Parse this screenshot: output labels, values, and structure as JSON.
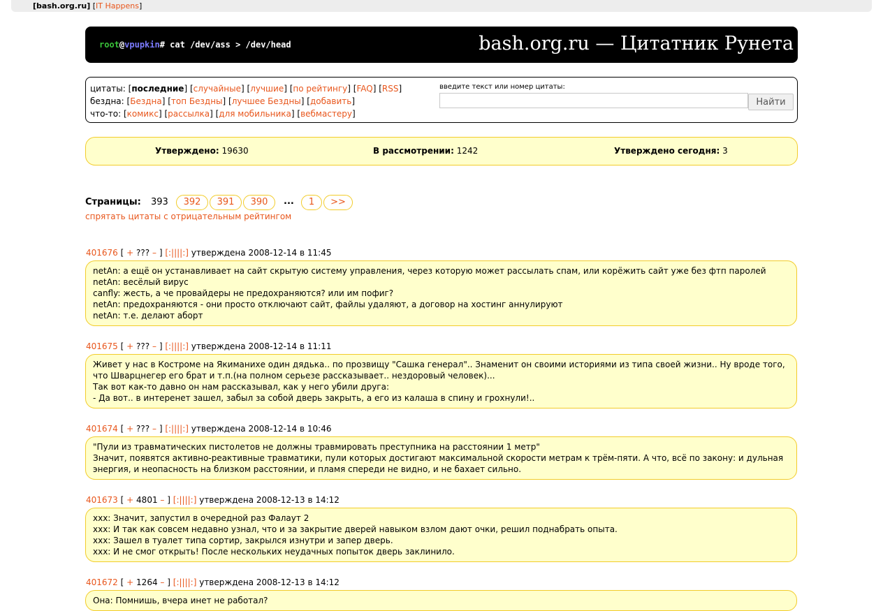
{
  "topbar": {
    "site": "bash.org.ru",
    "partner": "IT Happens"
  },
  "header": {
    "prompt_user": "root",
    "prompt_at": "@",
    "prompt_host": "vpupkin",
    "prompt_cmd": "# cat /dev/ass > /dev/head",
    "title": "bash.org.ru — Цитатник Рунета"
  },
  "menu": {
    "rows": [
      {
        "label": "цитаты:",
        "items": [
          {
            "text": "последние",
            "active": true
          },
          {
            "text": "случайные"
          },
          {
            "text": "лучшие"
          },
          {
            "text": "по рейтингу"
          },
          {
            "text": "FAQ"
          },
          {
            "text": "RSS"
          }
        ]
      },
      {
        "label": "бездна:",
        "items": [
          {
            "text": "Бездна"
          },
          {
            "text": "топ Бездны"
          },
          {
            "text": "лучшее Бездны"
          },
          {
            "text": "добавить"
          }
        ]
      },
      {
        "label": "что-то:",
        "items": [
          {
            "text": "комикс"
          },
          {
            "text": "рассылка"
          },
          {
            "text": "для мобильника"
          },
          {
            "text": "вебмастеру"
          }
        ]
      }
    ]
  },
  "search": {
    "label": "введите текст или номер цитаты:",
    "value": "",
    "button": "Найти"
  },
  "stats": {
    "approved_label": "Утверждено:",
    "approved": "19630",
    "pending_label": "В рассмотрении:",
    "pending": "1242",
    "today_label": "Утверждено сегодня:",
    "today": "3"
  },
  "pagination": {
    "label": "Страницы:",
    "current": "393",
    "pages": [
      "392",
      "391",
      "390"
    ],
    "dots": "...",
    "first": "1",
    "next": ">>"
  },
  "hide_negative": "спрятать цитаты с отрицательным рейтингом",
  "quotes": [
    {
      "id": "401676",
      "rating": "???",
      "date": "утверждена 2008-12-14 в 11:45",
      "lines": [
        "netAn: а ещё он устанавливает на сайт скрытую систему управления, через которую может рассылать спам, или корёжить сайт уже без фтп паролей",
        "netAn: весёлый вирус",
        "canfly: жесть, а че провайдеры не предохраняются? или им пофиг?",
        "netAn: предохраняются - они просто отключают сайт, файлы удаляют, а договор на хостинг аннулируют",
        "netAn: т.е. делают аборт"
      ]
    },
    {
      "id": "401675",
      "rating": "???",
      "date": "утверждена 2008-12-14 в 11:11",
      "lines": [
        "Живет у нас в Костроме на Якиманихе один дядька.. по прозвищу \"Сашка генерал\".. Знаменит он своими историями из типа своей жизни.. Ну вроде того, что Шварцнегер его брат и т.п.(на полном серьезе рассказывает.. нездоровый человек)...",
        "Так вот как-то давно он нам рассказывал, как у него убили друга:",
        "- Да вот.. в интеренет зашел, забыл за собой дверь закрыть, а его из калаша в спину и грохнули!.."
      ]
    },
    {
      "id": "401674",
      "rating": "???",
      "date": "утверждена 2008-12-14 в 10:46",
      "lines": [
        "\"Пули из травматических пистолетов не должны травмировать преступника на расстоянии 1 метр\"",
        "Значит, появятся активно-реактивные травматики, пули которых достигают максимальной скорости метрам к трём-пяти. А что, всё по закону: и дульная энергия, и неопасность на близком расстоянии, и пламя спереди не видно, и не бахает сильно."
      ]
    },
    {
      "id": "401673",
      "rating": "4801",
      "date": "утверждена 2008-12-13 в 14:12",
      "lines": [
        "xxx: Значит, запустил в очередной раз Фалаут 2",
        "xxx: И так как совсем недавно узнал, что и за закрытие дверей навыком взлом дают очки, решил поднабрать опыта.",
        "xxx: Зашел в туалет типа сортир, закрылся изнутри и запер дверь.",
        "xxx: И не смог открыть! После нескольких неудачных попыток дверь заклинило."
      ]
    },
    {
      "id": "401672",
      "rating": "1264",
      "date": "утверждена 2008-12-13 в 14:12",
      "lines": [
        "Она: Помнишь, вчера инет не работал?"
      ]
    }
  ],
  "vote": {
    "plus": "+",
    "minus": "–",
    "bayan": "[:||||:]",
    "open": "[",
    "close": "]"
  },
  "colors": {
    "link": "#e8561c",
    "quote_bg": "#ffffcc",
    "quote_border": "#f2cc2a",
    "header_bg": "#000000"
  }
}
